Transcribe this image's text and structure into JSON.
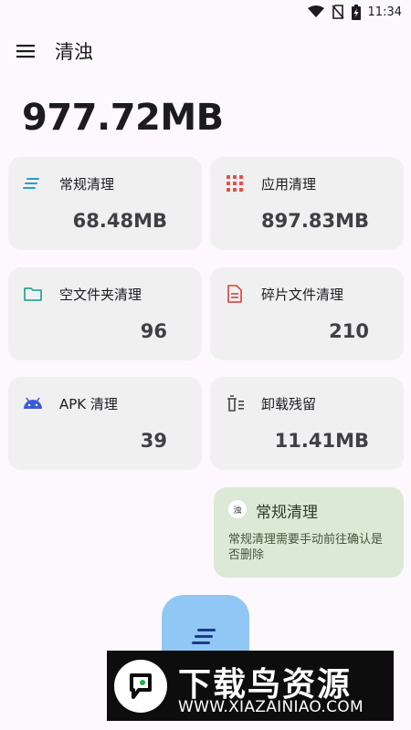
{
  "status_bar": {
    "time": "11:34",
    "icons": [
      "wifi-icon",
      "sim-off-icon",
      "battery-charging-icon"
    ]
  },
  "app_bar": {
    "title": "清浊",
    "menu_icon": "hamburger-menu-icon"
  },
  "summary": {
    "total_size": "977.72MB"
  },
  "cards": [
    {
      "icon": "list-lines-icon",
      "label": "常规清理",
      "value": "68.48MB",
      "accent": "#2a9cc9"
    },
    {
      "icon": "app-grid-icon",
      "label": "应用清理",
      "value": "897.83MB",
      "accent": "#e0534a"
    },
    {
      "icon": "folder-icon",
      "label": "空文件夹清理",
      "value": "96",
      "accent": "#2aa89a"
    },
    {
      "icon": "document-icon",
      "label": "碎片文件清理",
      "value": "210",
      "accent": "#e0534a"
    },
    {
      "icon": "android-icon",
      "label": "APK 清理",
      "value": "39",
      "accent": "#3c5bd6"
    },
    {
      "icon": "uninstall-trash-icon",
      "label": "卸载残留",
      "value": "11.41MB",
      "accent": "#444444"
    }
  ],
  "tip": {
    "icon_text": "浊",
    "title": "常规清理",
    "body": "常规清理需要手动前往确认是否删除",
    "background": "#dbe9d6"
  },
  "fab": {
    "icon": "clean-lines-icon",
    "color": "#90c7f4"
  },
  "watermark": {
    "text": "下载鸟资源",
    "url": "WWW.XIAZAINIAO.COM"
  }
}
